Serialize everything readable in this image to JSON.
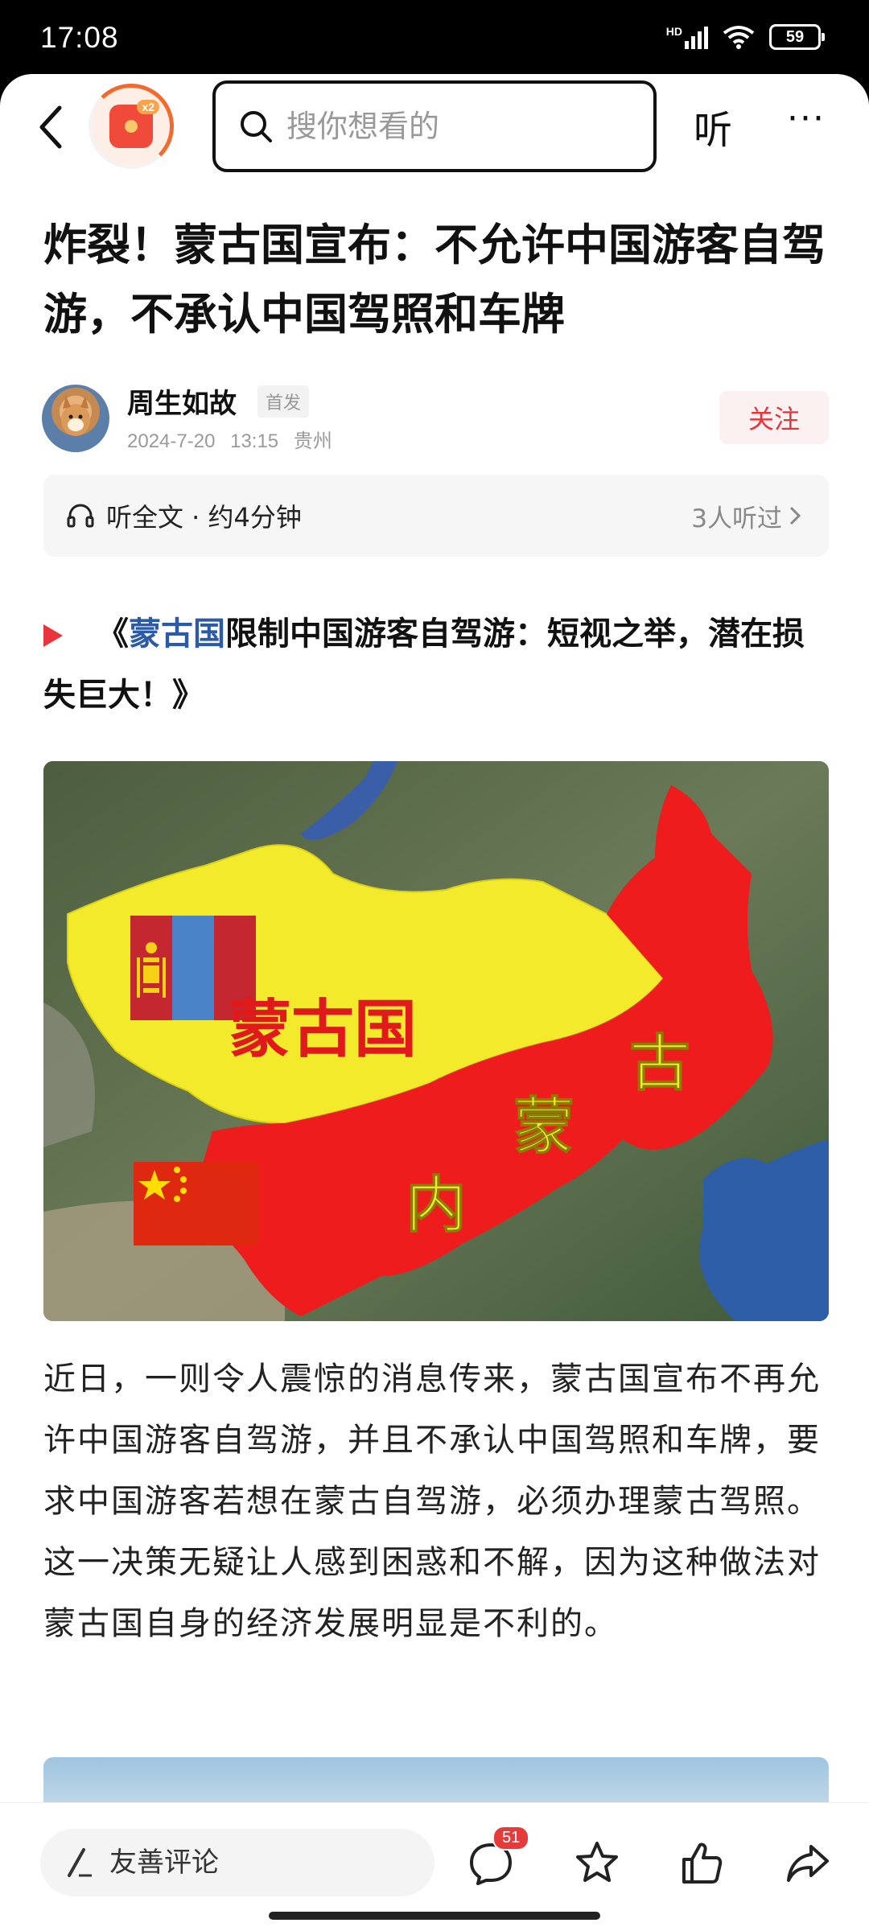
{
  "status": {
    "time": "17:08",
    "signal": "HD",
    "battery": "59"
  },
  "nav": {
    "search_placeholder": "搜你想看的",
    "listen_label": "听",
    "more_label": "···",
    "badge_text": "x2"
  },
  "article": {
    "title": "炸裂！蒙古国宣布：不允许中国游客自驾游，不承认中国驾照和车牌",
    "author": {
      "name": "周生如故",
      "tag": "首发",
      "date": "2024-7-20",
      "time": "13:15",
      "location": "贵州",
      "follow_label": "关注"
    },
    "listen_bar": {
      "label": "听全文 · 约4分钟",
      "count": "3人听过"
    },
    "quote": {
      "open": "《",
      "link": "蒙古国",
      "rest": "限制中国游客自驾游：短视之举，潜在损失巨大！",
      "close": "》"
    },
    "map_labels": {
      "mongolia": "蒙古国",
      "inner_1": "内",
      "inner_2": "蒙",
      "inner_3": "古"
    },
    "body": "近日，一则令人震惊的消息传来，蒙古国宣布不再允许中国游客自驾游，并且不承认中国驾照和车牌，要求中国游客若想在蒙古自驾游，必须办理蒙古驾照。这一决策无疑让人感到困惑和不解，因为这种做法对蒙古国自身的经济发展明显是不利的。"
  },
  "bottom": {
    "comment_placeholder": "友善评论",
    "comment_count": "51"
  },
  "colors": {
    "accent_red": "#e2363b",
    "link_blue": "#2b5aa8",
    "mongolia_yellow": "#f2ea2a",
    "inner_mongolia_red": "#ee1c1c"
  }
}
